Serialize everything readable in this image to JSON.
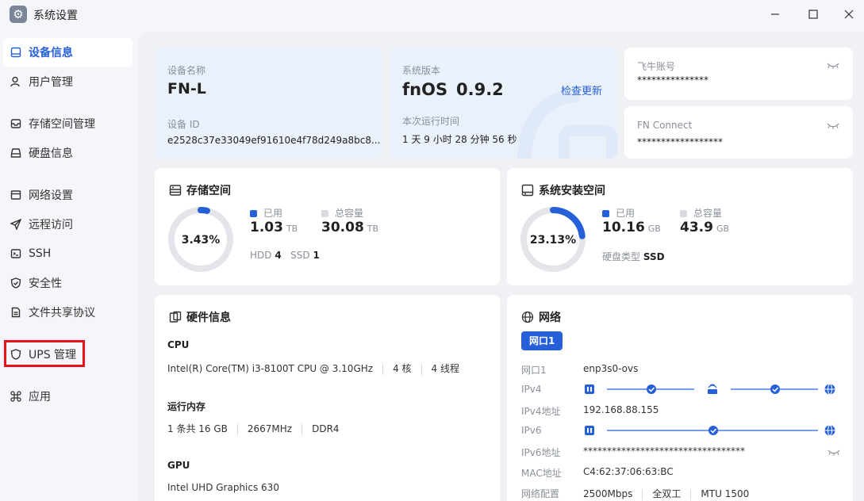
{
  "window": {
    "title": "系统设置",
    "app_icon": "gear-icon"
  },
  "sidebar": {
    "items": [
      {
        "label": "设备信息",
        "icon": "device-icon",
        "active": true
      },
      {
        "label": "用户管理",
        "icon": "user-icon"
      },
      {
        "label": "存储空间管理",
        "icon": "storage-icon"
      },
      {
        "label": "硬盘信息",
        "icon": "disk-icon"
      },
      {
        "label": "网络设置",
        "icon": "network-icon"
      },
      {
        "label": "远程访问",
        "icon": "send-icon"
      },
      {
        "label": "SSH",
        "icon": "terminal-icon"
      },
      {
        "label": "安全性",
        "icon": "shield-check-icon"
      },
      {
        "label": "文件共享协议",
        "icon": "file-icon"
      },
      {
        "label": "UPS 管理",
        "icon": "shield-icon"
      },
      {
        "label": "应用",
        "icon": "command-icon"
      }
    ]
  },
  "device": {
    "name_label": "设备名称",
    "name": "FN-L",
    "id_label": "设备 ID",
    "id": "e2528c37e33049ef91610e4f78d249a8bc8..."
  },
  "version": {
    "label": "系统版本",
    "os": "fnOS",
    "number": "0.9.2",
    "check_link": "检查更新",
    "uptime_label": "本次运行时间",
    "uptime": "1 天 9 小时 28 分钟 56 秒"
  },
  "account": {
    "label": "飞牛账号",
    "value": "***************"
  },
  "connect": {
    "label": "FN Connect",
    "value": "******************"
  },
  "storage": {
    "title": "存储空间",
    "percent_text": "3.43%",
    "percent": 3.43,
    "used_label": "已用",
    "used": "1.03",
    "used_unit": "TB",
    "total_label": "总容量",
    "total": "30.08",
    "total_unit": "TB",
    "hdd_label": "HDD",
    "hdd": "4",
    "ssd_label": "SSD",
    "ssd": "1"
  },
  "sys_install": {
    "title": "系统安装空间",
    "percent_text": "23.13%",
    "percent": 23.13,
    "used_label": "已用",
    "used": "10.16",
    "used_unit": "GB",
    "total_label": "总容量",
    "total": "43.9",
    "total_unit": "GB",
    "disk_type_label": "硬盘类型",
    "disk_type": "SSD"
  },
  "hardware": {
    "title": "硬件信息",
    "cpu_title": "CPU",
    "cpu_model": "Intel(R) Core(TM) i3-8100T CPU @ 3.10GHz",
    "cpu_cores": "4 核",
    "cpu_threads": "4 线程",
    "mem_title": "运行内存",
    "mem_size": "1 条共 16 GB",
    "mem_freq": "2667MHz",
    "mem_type": "DDR4",
    "gpu_title": "GPU",
    "gpu_model": "Intel UHD Graphics 630"
  },
  "network": {
    "title": "网络",
    "port_tab": "网口1",
    "rows": {
      "port_label": "网口1",
      "port_value": "enp3s0-ovs",
      "ipv4_label": "IPv4",
      "ipv4_addr_label": "IPv4地址",
      "ipv4_addr": "192.168.88.155",
      "ipv6_label": "IPv6",
      "ipv6_addr_label": "IPv6地址",
      "ipv6_addr": "**********************************",
      "mac_label": "MAC地址",
      "mac": "C4:62:37:06:63:BC",
      "config_label": "网络配置",
      "speed": "2500Mbps",
      "duplex": "全双工",
      "mtu": "MTU 1500"
    }
  },
  "colors": {
    "accent": "#2660d9",
    "ring_track": "#e3e5ea",
    "highlight": "#e8101a"
  }
}
